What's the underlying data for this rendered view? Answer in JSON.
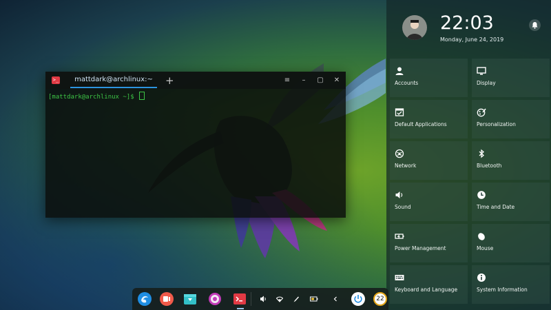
{
  "terminal": {
    "tab_title": "mattdark@archlinux:~",
    "new_tab_symbol": "+",
    "prompt": "[mattdark@archlinux ~]$ ",
    "controls": {
      "menu": "≡",
      "minimize": "–",
      "maximize": "▢",
      "close": "✕"
    }
  },
  "panel": {
    "time": "22:03",
    "date": "Monday, June 24, 2019",
    "tiles": [
      {
        "label": "Accounts",
        "icon": "user-icon"
      },
      {
        "label": "Display",
        "icon": "monitor-icon"
      },
      {
        "label": "Default Applications",
        "icon": "default-apps-icon"
      },
      {
        "label": "Personalization",
        "icon": "palette-icon"
      },
      {
        "label": "Network",
        "icon": "network-icon"
      },
      {
        "label": "Bluetooth",
        "icon": "bluetooth-icon"
      },
      {
        "label": "Sound",
        "icon": "speaker-icon"
      },
      {
        "label": "Time and Date",
        "icon": "clock-icon"
      },
      {
        "label": "Power Management",
        "icon": "battery-icon"
      },
      {
        "label": "Mouse",
        "icon": "mouse-icon"
      },
      {
        "label": "Keyboard and Language",
        "icon": "keyboard-icon"
      },
      {
        "label": "System Information",
        "icon": "info-icon"
      }
    ]
  },
  "dock": {
    "clock_icon_text": "22"
  },
  "colors": {
    "accent_blue": "#2b94e0",
    "terminal_green": "#3dc546",
    "terminal_red_icon": "#e13a44"
  }
}
